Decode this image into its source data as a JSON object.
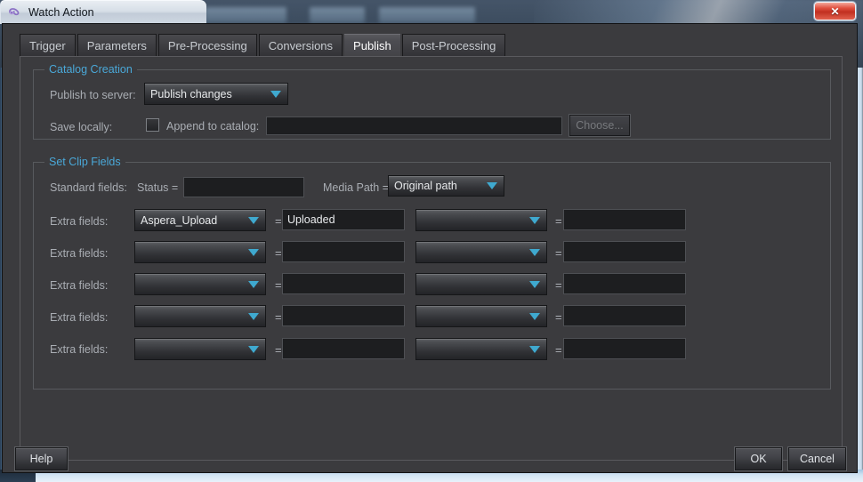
{
  "window": {
    "title": "Watch Action",
    "title_icon": "app-swirl-icon",
    "close_label": "✕"
  },
  "tabs": [
    {
      "label": "Trigger",
      "selected": false
    },
    {
      "label": "Parameters",
      "selected": false
    },
    {
      "label": "Pre-Processing",
      "selected": false
    },
    {
      "label": "Conversions",
      "selected": false
    },
    {
      "label": "Publish",
      "selected": true
    },
    {
      "label": "Post-Processing",
      "selected": false
    }
  ],
  "catalog_creation": {
    "group_title": "Catalog Creation",
    "publish_to_server_label": "Publish to server:",
    "publish_to_server_value": "Publish changes",
    "save_locally_label": "Save locally:",
    "append_to_catalog_label": "Append to catalog:",
    "append_to_catalog_value": "",
    "append_checked": false,
    "choose_label": "Choose...",
    "choose_disabled": true
  },
  "set_clip_fields": {
    "group_title": "Set Clip Fields",
    "standard_fields_label": "Standard fields:",
    "status_label": "Status =",
    "status_value": "",
    "media_path_label": "Media Path =",
    "media_path_value": "Original path",
    "extra_fields_label": "Extra fields:",
    "equals_label": "=",
    "rows": [
      {
        "name_a": "Aspera_Upload",
        "value_a": "Uploaded",
        "name_b": "",
        "value_b": ""
      },
      {
        "name_a": "",
        "value_a": "",
        "name_b": "",
        "value_b": ""
      },
      {
        "name_a": "",
        "value_a": "",
        "name_b": "",
        "value_b": ""
      },
      {
        "name_a": "",
        "value_a": "",
        "name_b": "",
        "value_b": ""
      },
      {
        "name_a": "",
        "value_a": "",
        "name_b": "",
        "value_b": ""
      }
    ]
  },
  "footer": {
    "help_label": "Help",
    "ok_label": "OK",
    "cancel_label": "Cancel"
  },
  "colors": {
    "accent": "#4aa8d8",
    "arrow": "#3fa9cf",
    "dialog_bg": "#3b3b3e",
    "input_bg": "#1d1e20"
  }
}
